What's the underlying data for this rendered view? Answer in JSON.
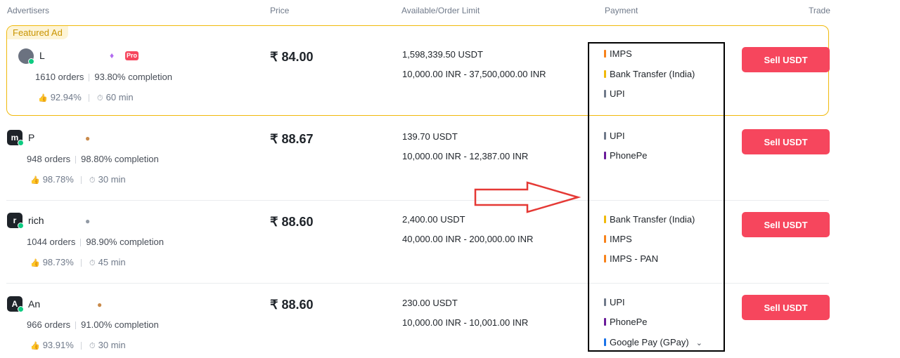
{
  "headers": {
    "advertisers": "Advertisers",
    "price": "Price",
    "available": "Available/Order Limit",
    "payment": "Payment",
    "trade": "Trade"
  },
  "featured_label": "Featured Ad",
  "currency_symbol": "₹",
  "rows": [
    {
      "avatar": "",
      "name": "L",
      "orders": "1610 orders",
      "completion": "93.80% completion",
      "rating": "92.94%",
      "time": "60 min",
      "price": "84.00",
      "available": "1,598,339.50 USDT",
      "limit": "10,000.00 INR - 37,500,000.00 INR",
      "payments": [
        {
          "label": "IMPS",
          "color": "#f7821b"
        },
        {
          "label": "Bank Transfer (India)",
          "color": "#f0b90b"
        },
        {
          "label": "UPI",
          "color": "#707a8a"
        }
      ],
      "button": "Sell USDT"
    },
    {
      "avatar": "m",
      "name": "P",
      "orders": "948 orders",
      "completion": "98.80% completion",
      "rating": "98.78%",
      "time": "30 min",
      "price": "88.67",
      "available": "139.70 USDT",
      "limit": "10,000.00 INR - 12,387.00 INR",
      "payments": [
        {
          "label": "UPI",
          "color": "#707a8a"
        },
        {
          "label": "PhonePe",
          "color": "#6a1b9a"
        }
      ],
      "button": "Sell USDT"
    },
    {
      "avatar": "r",
      "name": "rich",
      "orders": "1044 orders",
      "completion": "98.90% completion",
      "rating": "98.73%",
      "time": "45 min",
      "price": "88.60",
      "available": "2,400.00 USDT",
      "limit": "40,000.00 INR - 200,000.00 INR",
      "payments": [
        {
          "label": "Bank Transfer (India)",
          "color": "#f0b90b"
        },
        {
          "label": "IMPS",
          "color": "#f7821b"
        },
        {
          "label": "IMPS - PAN",
          "color": "#f7821b"
        }
      ],
      "button": "Sell USDT"
    },
    {
      "avatar": "A",
      "name": "An",
      "orders": "966 orders",
      "completion": "91.00% completion",
      "rating": "93.91%",
      "time": "30 min",
      "price": "88.60",
      "available": "230.00 USDT",
      "limit": "10,000.00 INR - 10,001.00 INR",
      "payments": [
        {
          "label": "UPI",
          "color": "#707a8a"
        },
        {
          "label": "PhonePe",
          "color": "#6a1b9a"
        },
        {
          "label": "Google Pay (GPay)",
          "color": "#1a73e8"
        }
      ],
      "button": "Sell USDT"
    }
  ],
  "colors": {
    "sell": "#f6465d",
    "featured_border": "#f0b90b",
    "online": "#0ecb81"
  },
  "icons": [
    "thumbs-up-icon",
    "timer-icon",
    "verified-diamond-icon",
    "cookie-badge-icon",
    "chevron-down-icon",
    "red-arrow-annotation",
    "highlight-box-annotation"
  ]
}
